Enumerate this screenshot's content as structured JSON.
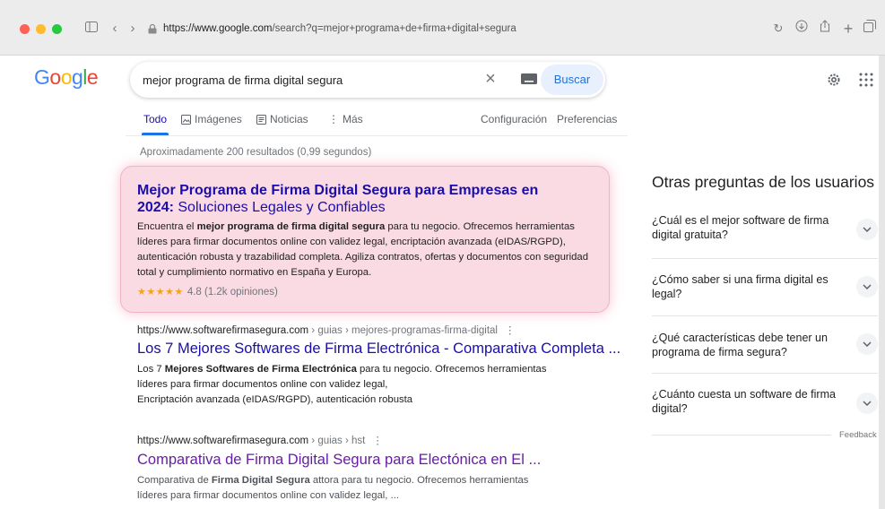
{
  "browser": {
    "url_host": "https://www.google.com",
    "url_path": "/search?q=mejor+programa+de+firma+digital+segura"
  },
  "logo": "Google",
  "search": {
    "query": "mejor programa de firma digital segura",
    "button_label": "Buscar"
  },
  "tabs": {
    "todo": "Todo",
    "imagenes": "Imágenes",
    "noticias": "Noticias",
    "mas": "Más",
    "configuracion": "Configuración",
    "preferencias": "Preferencias"
  },
  "stats": "Aproximadamente 200 resultados (0,99 segundos)",
  "ad": {
    "title_bold": "Mejor Programa de Firma Digital Segura para Empresas en 2024:",
    "title_rest": " Soluciones Legales y Confiables",
    "desc_pre": "Encuentra el ",
    "desc_bold": "mejor programa de firma digital segura",
    "desc_post": " para tu negocio. Ofrecemos herramientas líderes para firmar documentos online con validez legal, encriptación avanzada (eIDAS/RGPD), autenticación robusta y trazabilidad completa. Agiliza contratos, ofertas y documentos con seguridad total y cumplimiento normativo en España y Europa.",
    "stars": "★★★★★",
    "rating": "4.8 (1.2k opiniones)"
  },
  "results": [
    {
      "url_host": "https://www.softwarefirmasegura.com",
      "url_path": " › guias › mejores-programas-firma-digital",
      "title": "Los 7 Mejores Softwares de Firma Electrónica - Comparativa Completa ...",
      "snippet_pre": "Los 7 ",
      "snippet_bold": "Mejores Softwares de Firma Electrónica",
      "snippet_post": " para tu negocio. Ofrecemos herramientas líderes para firmar documentos online con validez legal,",
      "snippet_line3": "Encriptación avanzada (eIDAS/RGPD), autenticación robusta"
    },
    {
      "url_host": "https://www.softwarefirmasegura.com",
      "url_path": " › guias › hst",
      "title": "Comparativa de Firma Digital Segura para Electónica en El ...",
      "snippet_pre": "Comparativa de ",
      "snippet_bold": "Firma Digital Segura",
      "snippet_post": " attora para tu negocio. Ofrecemos herramientas líderes para firmar documentos online con validez legal, ..."
    }
  ],
  "paa": {
    "title": "Otras preguntas de los usuarios",
    "questions": [
      "¿Cuál es el mejor software de firma digital gratuita?",
      "¿Cómo saber si una firma digital es legal?",
      "¿Qué características debe tener un programa de firma segura?",
      "¿Cuánto cuesta un software de firma digital?"
    ],
    "feedback": "Feedback"
  }
}
